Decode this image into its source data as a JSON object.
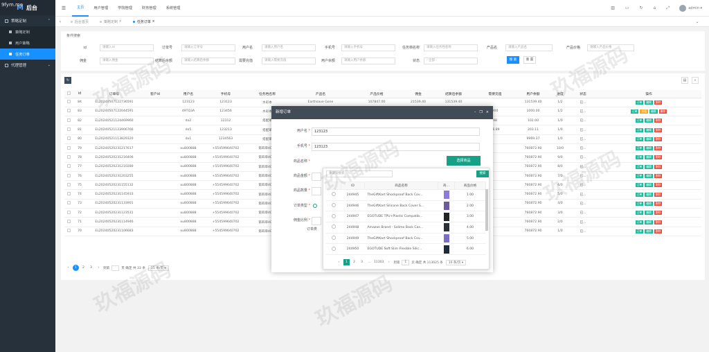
{
  "corner_text": "9fym.me",
  "app": {
    "logo_letter": "M",
    "title": "后台"
  },
  "sidebar": {
    "groups": [
      {
        "label": "策略定制",
        "items": [
          {
            "label": "策略定制"
          },
          {
            "label": "用户策略"
          },
          {
            "label": "任务订单"
          }
        ]
      },
      {
        "label": "代理管理"
      }
    ]
  },
  "topnav": [
    "主页",
    "用户管理",
    "学院管理",
    "财务管理",
    "系统管理"
  ],
  "user": {
    "name": "admin ▾"
  },
  "tabs": [
    "后台首页",
    "策略定制",
    "任务订单"
  ],
  "search": {
    "legend": "条件搜索",
    "row1": [
      {
        "label": "id",
        "placeholder": "请输入Id"
      },
      {
        "label": "订单号",
        "placeholder": "请输入订单号"
      },
      {
        "label": "用户名",
        "placeholder": "请输入用户名"
      },
      {
        "label": "手机号",
        "placeholder": "请输入手机号"
      },
      {
        "label": "任务档名称",
        "placeholder": "请输入任务档名称"
      },
      {
        "label": "产品名",
        "placeholder": "请输入产品名"
      },
      {
        "label": "产品价格",
        "placeholder": "请输入产品价格"
      }
    ],
    "row2": [
      {
        "label": "佣金",
        "placeholder": "请输入佣金"
      },
      {
        "label": "结算后余额",
        "placeholder": "请输入结算后余额"
      },
      {
        "label": "需要充值",
        "placeholder": "请输入需要充值"
      },
      {
        "label": "用户余额",
        "placeholder": "请输入用户余额"
      },
      {
        "label": "状态",
        "placeholder": "- 全部 -"
      }
    ],
    "search_label": "搜 索",
    "reset_label": "重 置"
  },
  "table": {
    "headers": [
      "id",
      "订单号",
      "客户id",
      "用户名",
      "手机号",
      "任务档名称",
      "产品名",
      "产品价格",
      "佣金",
      "结算后余额",
      "需要充值",
      "用户余额",
      "进度",
      "状态",
      "操作"
    ],
    "rows": [
      [
        "84",
        "EL20240507122736591",
        "",
        "123123",
        "123123",
        "水彩本",
        "Earthsave Gone",
        "107847.00",
        "21539.40",
        "131539.40",
        "",
        "131539.40",
        "1/2",
        "已..."
      ],
      [
        "83",
        "EL20240507122044591",
        "",
        "49TQ3A",
        "123456",
        "水彩本",
        "",
        "",
        "",
        "",
        "900",
        "1000.00",
        "1/2",
        "已..."
      ],
      [
        "82",
        "EL20240521124469960",
        "",
        "do2",
        "12312",
        "搭配单",
        "",
        "",
        "",
        "",
        "98",
        "102.00",
        "1/0",
        "已..."
      ],
      [
        "81",
        "EL20240521123906766",
        "",
        "do5",
        "123213",
        "搭配单",
        "",
        "",
        "",
        "",
        "96.89",
        "203.11",
        "1/0",
        "已..."
      ],
      [
        "80",
        "EL20240521113829320",
        "",
        "do1",
        "1234563",
        "搭配单",
        "",
        "",
        "",
        "",
        "",
        "9969.37",
        "1/0",
        "已..."
      ],
      [
        "79",
        "EL20240520231217617",
        "",
        "xu800888",
        "+554599640702",
        "第四单4000",
        "",
        "",
        "",
        "",
        "",
        "760872.90",
        "10/0",
        "已..."
      ],
      [
        "78",
        "EL20240520231216406",
        "",
        "xu800888",
        "+554599640702",
        "第四单4000",
        "",
        "",
        "",
        "",
        "",
        "760872.90",
        "9/0",
        "已..."
      ],
      [
        "77",
        "EL20240520231210280",
        "",
        "xu800888",
        "+554599640702",
        "第四单4000",
        "",
        "",
        "",
        "",
        "",
        "760872.90",
        "8/0",
        "已..."
      ],
      [
        "76",
        "EL20240520231203255",
        "",
        "xu800888",
        "+554599640702",
        "第四单4000",
        "",
        "",
        "",
        "",
        "",
        "760872.90",
        "7/0",
        "已..."
      ],
      [
        "75",
        "EL20240520231155132",
        "",
        "xu800888",
        "+554599640702",
        "第四单4000",
        "",
        "",
        "",
        "",
        "",
        "760872.90",
        "6/0",
        "已..."
      ],
      [
        "74",
        "EL20240520231145933",
        "",
        "xu800888",
        "+554599640702",
        "第四单4000",
        "",
        "",
        "",
        "",
        "",
        "760872.90",
        "5/0",
        "已..."
      ],
      [
        "73",
        "EL20240520231133901",
        "",
        "xu800888",
        "+554599640702",
        "第四单4000",
        "",
        "",
        "",
        "",
        "",
        "760872.90",
        "4/0",
        "已..."
      ],
      [
        "72",
        "EL20240520231123531",
        "",
        "xu800888",
        "+554599640702",
        "第四单4000",
        "",
        "",
        "",
        "",
        "",
        "760872.90",
        "3/0",
        "已..."
      ],
      [
        "71",
        "EL20240520231114946",
        "",
        "xu800888",
        "+554599640702",
        "第四单4000",
        "",
        "",
        "",
        "",
        "",
        "760872.90",
        "2/0",
        "已..."
      ],
      [
        "70",
        "EL20240520231106683",
        "",
        "xu800888",
        "+554599640702",
        "第四单4000",
        "",
        "",
        "",
        "",
        "",
        "760872.90",
        "1/0",
        "已..."
      ]
    ],
    "actions": [
      "订单",
      "编辑",
      "删除"
    ],
    "row83_actions": [
      "订单",
      "充值",
      "编辑",
      "删除"
    ]
  },
  "pager": {
    "pages": [
      "1",
      "2",
      "3"
    ],
    "goto": "到第",
    "unit": "页",
    "confirm": "确定",
    "total": "共 33 条",
    "per_page": "15 条/页 ▾"
  },
  "modal": {
    "title": "新增订单",
    "fields": {
      "username_label": "用户名",
      "username_value": "123123",
      "phone_label": "手机号",
      "phone_value": "123123",
      "product_label": "商品名称",
      "choose_label": "选择商品",
      "amount_label": "商品金额",
      "qty_label": "商品数量",
      "type_label": "订单类型",
      "commission_label": "佣金比例",
      "order_label": "订单类"
    },
    "dropdown": {
      "search_placeholder": "关键词搜索",
      "search_btn": "搜索",
      "headers": [
        "",
        "ID",
        "商品名称",
        "商...",
        "商品价格"
      ],
      "rows": [
        {
          "id": "244945",
          "name": "TheGiftKart Shockproof Back Cov...",
          "price": "1.00",
          "color": "#8c7cd8"
        },
        {
          "id": "244946",
          "name": "TheGiftKart Silicone Back Cover S...",
          "price": "2.00",
          "color": "#6b5a9c"
        },
        {
          "id": "244947",
          "name": "EGOTUDE TPU+Plastic Compatib...",
          "price": "3.00",
          "color": "#222428"
        },
        {
          "id": "244948",
          "name": "Amazon Brand - Solimo Back Cas...",
          "price": "4.00",
          "color": "#2b3038"
        },
        {
          "id": "244949",
          "name": "TheGiftKart Shockproof Back Cov...",
          "price": "5.00",
          "color": "#7b6cc6"
        },
        {
          "id": "244950",
          "name": "EGOTUDE Soft Slim Flexible Silic...",
          "price": "6.00",
          "color": "#1f2a3a"
        }
      ],
      "pages": [
        "1",
        "2",
        "3",
        "...",
        "11303"
      ],
      "goto": "到第",
      "page_value": "1",
      "unit": "页",
      "confirm": "确定",
      "total": "共 113025 条",
      "per_page": "10 条/页 ▾"
    }
  },
  "watermark": "玖福源码"
}
